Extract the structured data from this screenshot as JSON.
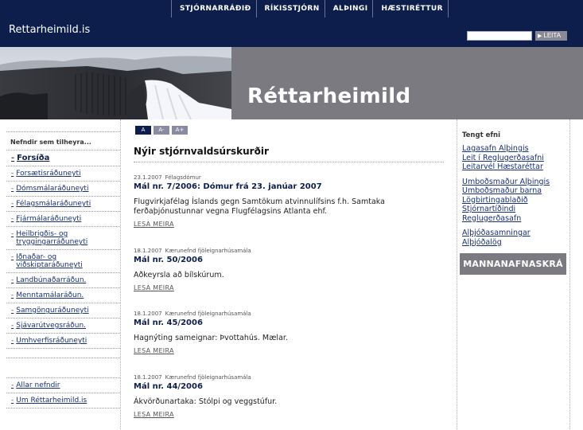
{
  "header": {
    "nav": [
      "STJÓRNARRÁÐIÐ",
      "RÍKISSTJÓRN",
      "ALÞINGI",
      "HÆSTIRÉTTUR"
    ],
    "logo": "Rettarheimild.is",
    "search_button": "LEITA",
    "search_value": ""
  },
  "banner": {
    "title": "Réttarheimild"
  },
  "fontsize": {
    "normal": "A",
    "smaller": "A-",
    "larger": "A+"
  },
  "leftnav": {
    "heading": "Nefndir sem tilheyra...",
    "items": [
      "Forsíða",
      "Forsætisráðuneyti",
      "Dómsmálaráðuneyti",
      "Félagsmálaráðuneyti",
      "Fjármálaráðuneyti",
      "Heilbrigðis- og tryggingarráðuneyti",
      "Iðnaðar- og viðskiptaráðuneyti",
      "Landbúnaðarráðun.",
      "Menntamálaráðun.",
      "Samgönguráðuneyti",
      "Sjávarútvegsráðun.",
      "Umhverfisráðuneyti"
    ],
    "bottom_items": [
      "Allar nefndir",
      "Um Réttarheimild.is"
    ]
  },
  "main": {
    "heading": "Nýir stjórnvaldsúrskurðir",
    "read_more": "LESA MEIRA",
    "entries": [
      {
        "date": "23.1.2007",
        "category": "Félagsdómur",
        "title": "Mál nr. 7/2006: Dómur frá 23. janúar 2007",
        "body": "Flugvirkjafélag Íslands gegn Samtökum atvinnulífsins f.h. Samtaka ferðaþjónustunnar vegna Flugfélagsins Atlanta ehf."
      },
      {
        "date": "18.1.2007",
        "category": "Kærunefnd fjöleignarhúsamála",
        "title": "Mál nr. 50/2006",
        "body": "Aðkeyrsla að bílskúrum."
      },
      {
        "date": "18.1.2007",
        "category": "Kærunefnd fjöleignarhúsamála",
        "title": "Mál nr. 45/2006",
        "body": "Hagnýting sameignar: Þvottahús. Mælar."
      },
      {
        "date": "18.1.2007",
        "category": "Kærunefnd fjöleignarhúsamála",
        "title": "Mál nr. 44/2006",
        "body": "Ákvörðunartaka: Stólpi og veggstúfur."
      }
    ]
  },
  "right": {
    "heading": "Tengt efni",
    "group1": [
      "Lagasafn Alþingis",
      "Leit í Reglugerðasafni",
      "Leitarvél Hæstaréttar"
    ],
    "group2": [
      "Umboðsmaður Alþingis",
      "Umboðsmaður barna",
      "Lögbirtingablaðið",
      "Stjórnartíðindi",
      "Reglugerðasafn"
    ],
    "group3": [
      "Alþjóðasamningar",
      "Alþjóðalög"
    ],
    "mannan_button": "MANNANAFNASKRÁ"
  },
  "colors": {
    "navy": "#0d1e4d",
    "banner_gray": "#7b7a80",
    "link": "#17307a"
  }
}
